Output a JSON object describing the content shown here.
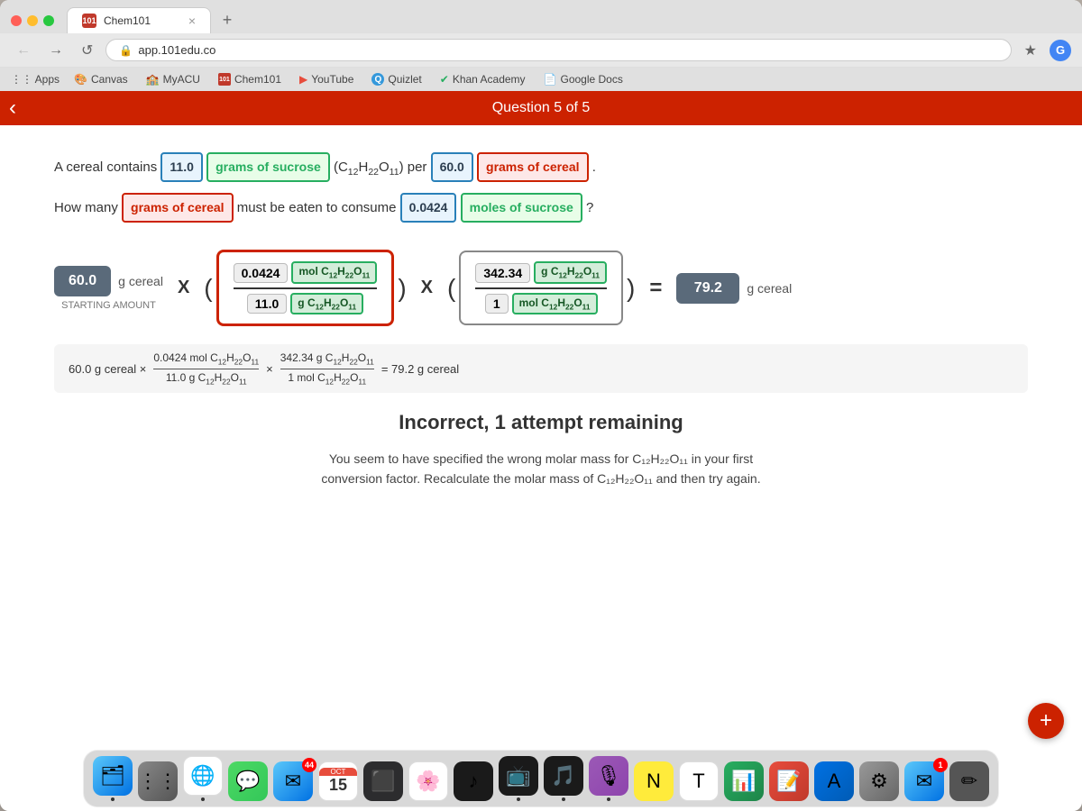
{
  "window": {
    "tab_title": "Chem101",
    "tab_icon": "101",
    "url": "app.101edu.co"
  },
  "bookmarks": {
    "apps_label": "Apps",
    "items": [
      {
        "label": "Canvas",
        "icon": "🎨"
      },
      {
        "label": "MyACU",
        "icon": "🏫"
      },
      {
        "label": "Chem101",
        "icon": "🔬"
      },
      {
        "label": "YouTube",
        "icon": "▶"
      },
      {
        "label": "Quizlet",
        "icon": "Q"
      },
      {
        "label": "Khan Academy",
        "icon": "✔"
      },
      {
        "label": "Google Docs",
        "icon": "📄"
      }
    ]
  },
  "question": {
    "header": "Question 5 of 5",
    "line1_prefix": "A cereal contains",
    "grams_sucrose_value": "11.0",
    "grams_sucrose_label": "grams of sucrose",
    "formula": "(C₁₂H₂₂O₁₁) per",
    "grams_cereal_value": "60.0",
    "grams_cereal_label": "grams of cereal",
    "line2_prefix": "How many",
    "grams_cereal_label2": "grams of cereal",
    "line2_middle": "must be eaten to consume",
    "moles_sucrose_value": "0.0424",
    "moles_sucrose_label": "moles of sucrose",
    "line2_suffix": "?"
  },
  "calculation": {
    "starting_value": "60.0",
    "starting_unit": "g cereal",
    "starting_label": "STARTING AMOUNT",
    "multiply": "X",
    "frac1_top_value": "0.0424",
    "frac1_top_unit": "mol C₁₂H₂₂O₁₁",
    "frac1_bottom_value": "11.0",
    "frac1_bottom_unit": "g C₁₂H₂₂O₁₁",
    "frac2_top_value": "342.34",
    "frac2_top_unit": "g C₁₂H₂₂O₁₁",
    "frac2_bottom_value": "1",
    "frac2_bottom_unit": "mol C₁₂H₂₂O₁₁",
    "equals": "=",
    "result_value": "79.2",
    "result_unit": "g cereal"
  },
  "long_equation": {
    "text": "60.0 g cereal × (0.0424 mol C₁₂H₂₂O₁₁) / (11.0 g C₁₂H₂₂O₁₁) × (342.34 g C₁₂H₂₂O₁₁) / (1 mol C₁₂H₂₂O₁₁) = 79.2 g cereal"
  },
  "feedback": {
    "title": "Incorrect, 1 attempt remaining",
    "line1": "You seem to have specified the wrong molar mass for C₁₂H₂₂O₁₁ in your first",
    "line2": "conversion factor. Recalculate the molar mass of C₁₂H₂₂O₁₁ and then try again."
  },
  "dock": {
    "items": [
      {
        "label": "Finder",
        "bg": "#4a90d9",
        "symbol": "🔵"
      },
      {
        "label": "Launchpad",
        "bg": "#888",
        "symbol": "⋮⋮"
      },
      {
        "label": "Chrome",
        "bg": "#fff",
        "symbol": "🌐"
      },
      {
        "label": "Messages",
        "bg": "#4cd964",
        "symbol": "💬"
      },
      {
        "label": "Mail",
        "bg": "#4a90d9",
        "symbol": "✉",
        "badge": "44"
      },
      {
        "label": "Calendar",
        "bg": "#fff",
        "symbol": "📅",
        "date": "15"
      },
      {
        "label": "Finder2",
        "bg": "#555",
        "symbol": "⬛"
      },
      {
        "label": "Photos",
        "bg": "#fff",
        "symbol": "🌸"
      },
      {
        "label": "Music",
        "bg": "#1a1a1a",
        "symbol": "♪"
      },
      {
        "label": "AppleTV",
        "bg": "#1a1a1a",
        "symbol": "📺"
      },
      {
        "label": "Music2",
        "bg": "#1a1a1a",
        "symbol": "🎵"
      },
      {
        "label": "Podcasts",
        "bg": "#9b59b6",
        "symbol": "🎙"
      },
      {
        "label": "Notes",
        "bg": "#ffeb3b",
        "symbol": "N"
      },
      {
        "label": "TextEdit",
        "bg": "#fff",
        "symbol": "T"
      },
      {
        "label": "Numbers",
        "bg": "#27ae60",
        "symbol": "📊"
      },
      {
        "label": "Pages",
        "bg": "#e74c3c",
        "symbol": "📝"
      },
      {
        "label": "AppStore",
        "bg": "#0071e3",
        "symbol": "A"
      },
      {
        "label": "SystemPrefs",
        "bg": "#888",
        "symbol": "⚙"
      },
      {
        "label": "Mail2",
        "bg": "#4a90d9",
        "symbol": "✉",
        "badge": "1"
      },
      {
        "label": "Pen",
        "bg": "#555",
        "symbol": "✏"
      }
    ]
  }
}
